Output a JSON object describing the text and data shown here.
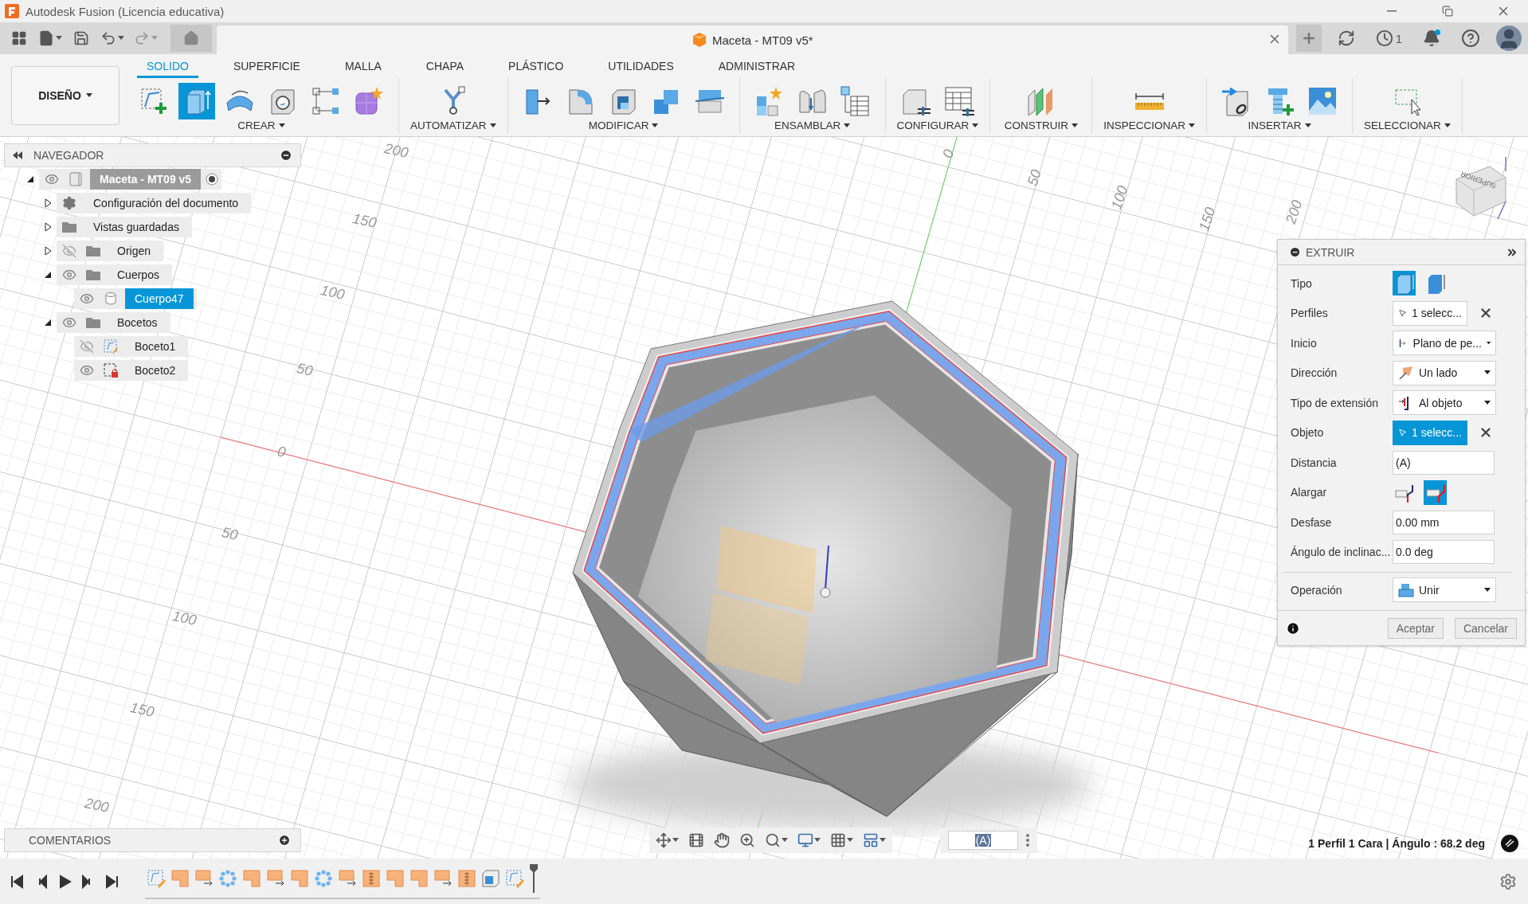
{
  "window": {
    "title": "Autodesk Fusion (Licencia educativa)"
  },
  "top_bar": {
    "document_tab": {
      "title": "Maceta - MT09 v5*"
    },
    "job_count": "1"
  },
  "ribbon": {
    "workspace": "DISEÑO",
    "tabs": [
      {
        "label": "SOLIDO",
        "selected": true
      },
      {
        "label": "SUPERFICIE",
        "selected": false
      },
      {
        "label": "MALLA",
        "selected": false
      },
      {
        "label": "CHAPA",
        "selected": false
      },
      {
        "label": "PLÁSTICO",
        "selected": false
      },
      {
        "label": "UTILIDADES",
        "selected": false
      },
      {
        "label": "ADMINISTRAR",
        "selected": false
      }
    ],
    "groups": [
      {
        "label": "CREAR",
        "tools": [
          {
            "kind": "sketch",
            "selected": false
          },
          {
            "kind": "extrude",
            "selected": true
          },
          {
            "kind": "revolve",
            "selected": false
          },
          {
            "kind": "hole",
            "selected": false
          },
          {
            "kind": "pattern",
            "selected": false
          },
          {
            "kind": "form",
            "selected": false
          }
        ]
      },
      {
        "label": "AUTOMATIZAR",
        "tools": [
          {
            "kind": "automate",
            "selected": false
          }
        ]
      },
      {
        "label": "MODIFICAR",
        "tools": [
          {
            "kind": "presspull",
            "selected": false
          },
          {
            "kind": "fillet",
            "selected": false
          },
          {
            "kind": "shell",
            "selected": false
          },
          {
            "kind": "combine",
            "selected": false
          },
          {
            "kind": "split",
            "selected": false
          }
        ]
      },
      {
        "label": "ENSAMBLAR",
        "tools": [
          {
            "kind": "newcomp",
            "selected": false
          },
          {
            "kind": "joint",
            "selected": false
          },
          {
            "kind": "bom",
            "selected": false
          }
        ]
      },
      {
        "label": "CONFIGURAR",
        "tools": [
          {
            "kind": "param",
            "selected": false
          },
          {
            "kind": "paramtable",
            "selected": false
          }
        ]
      },
      {
        "label": "CONSTRUIR",
        "tools": [
          {
            "kind": "plane",
            "selected": false
          }
        ]
      },
      {
        "label": "INSPECCIONAR",
        "tools": [
          {
            "kind": "measure",
            "selected": false
          }
        ]
      },
      {
        "label": "INSERTAR",
        "tools": [
          {
            "kind": "insertlink",
            "selected": false
          },
          {
            "kind": "bolt",
            "selected": false
          },
          {
            "kind": "image",
            "selected": false
          }
        ]
      },
      {
        "label": "SELECCIONAR",
        "tools": [
          {
            "kind": "select",
            "selected": false
          }
        ]
      }
    ]
  },
  "navigator": {
    "title": "NAVEGADOR",
    "items": [
      {
        "label": "Maceta - MT09 v5",
        "kind": "component",
        "visible": true,
        "expanded": true,
        "active": true,
        "selected": false,
        "children": [
          {
            "label": "Configuración del documento",
            "kind": "settings",
            "expanded": false,
            "selected": false
          },
          {
            "label": "Vistas guardadas",
            "kind": "folder",
            "expanded": false,
            "selected": false
          },
          {
            "label": "Origen",
            "kind": "folder",
            "visible": false,
            "expanded": false,
            "selected": false
          },
          {
            "label": "Cuerpos",
            "kind": "folder",
            "visible": true,
            "expanded": true,
            "selected": false,
            "children": [
              {
                "label": "Cuerpo47",
                "kind": "body",
                "visible": true,
                "selected": true
              }
            ]
          },
          {
            "label": "Bocetos",
            "kind": "folder",
            "visible": true,
            "expanded": true,
            "selected": false,
            "children": [
              {
                "label": "Boceto1",
                "kind": "sketch",
                "visible": false,
                "selected": false
              },
              {
                "label": "Boceto2",
                "kind": "locked-sketch",
                "visible": true,
                "selected": false
              }
            ]
          }
        ]
      }
    ]
  },
  "viewport": {
    "ruler_labels": [
      "200",
      "150",
      "100",
      "50",
      "0",
      "50",
      "100",
      "150",
      "200",
      "0",
      "50",
      "100",
      "150",
      "200"
    ],
    "viewcube_label": "SUPERIOR"
  },
  "extrude_panel": {
    "title": "EXTRUIR",
    "rows": [
      {
        "label": "Tipo",
        "kind": "toggle",
        "options": [
          {
            "kind": "solid",
            "selected": true
          },
          {
            "kind": "surface",
            "selected": false
          }
        ]
      },
      {
        "label": "Perfiles",
        "kind": "select",
        "value": "1 selecc...",
        "selected": false
      },
      {
        "label": "Inicio",
        "kind": "dropdown",
        "value": "Plano de pe..."
      },
      {
        "label": "Dirección",
        "kind": "dropdown",
        "value": "Un lado"
      },
      {
        "label": "Tipo de extensión",
        "kind": "dropdown",
        "value": "Al objeto"
      },
      {
        "label": "Objeto",
        "kind": "select",
        "value": "1 selecc...",
        "selected": true
      },
      {
        "label": "Distancia",
        "kind": "input",
        "value": "(A)"
      },
      {
        "label": "Alargar",
        "kind": "toggle",
        "options": [
          {
            "kind": "minimal",
            "selected": false
          },
          {
            "kind": "maximal",
            "selected": true
          }
        ]
      },
      {
        "label": "Desfase",
        "kind": "input",
        "value": "0.00 mm"
      },
      {
        "label": "Ángulo de inclinac...",
        "kind": "input",
        "value": "0.0 deg"
      },
      {
        "label": "Operación",
        "kind": "dropdown",
        "value": "Unir",
        "divider_before": true
      }
    ],
    "buttons": [
      "Aceptar",
      "Cancelar"
    ]
  },
  "comments": {
    "title": "COMENTARIOS"
  },
  "nav_bar": {
    "input_value": "(A)"
  },
  "status": "1 Perfil 1 Cara | Ángulo : 68.2 deg",
  "timeline": {
    "features": [
      {
        "kind": "sketch"
      },
      {
        "kind": "extrude"
      },
      {
        "kind": "move"
      },
      {
        "kind": "pattern"
      },
      {
        "kind": "extrude"
      },
      {
        "kind": "move"
      },
      {
        "kind": "extrude"
      },
      {
        "kind": "pattern"
      },
      {
        "kind": "move"
      },
      {
        "kind": "rib"
      },
      {
        "kind": "extrude"
      },
      {
        "kind": "extrude"
      },
      {
        "kind": "move"
      },
      {
        "kind": "rib"
      },
      {
        "kind": "shell"
      },
      {
        "kind": "sketch"
      }
    ]
  }
}
